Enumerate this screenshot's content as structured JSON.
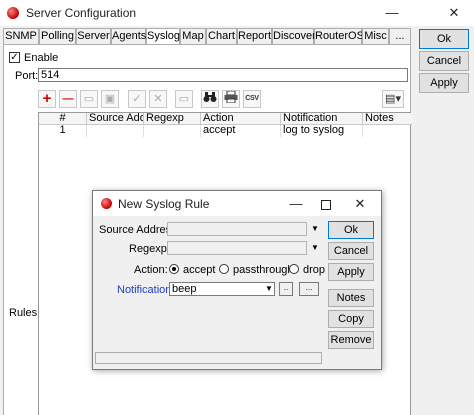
{
  "window": {
    "title": "Server Configuration",
    "minimize": "—",
    "close": "✕"
  },
  "tabs": [
    "SNMP",
    "Polling",
    "Server",
    "Agents",
    "Syslog",
    "Map",
    "Chart",
    "Report",
    "Discover",
    "RouterOS",
    "Misc",
    "..."
  ],
  "active_tab": "Syslog",
  "side_buttons": {
    "ok": "Ok",
    "cancel": "Cancel",
    "apply": "Apply"
  },
  "syslog": {
    "enable_label": "Enable",
    "enable_checked": "✓",
    "port_label": "Port:",
    "port_value": "514",
    "rules_label": "Rules:"
  },
  "toolbar": {
    "add": "+",
    "remove": "—",
    "find_icon": "binoculars-icon",
    "print_icon": "printer-icon",
    "csv": "CSV",
    "columns": "▾"
  },
  "rules_table": {
    "headers": [
      "#",
      "Source Add...",
      "Regexp",
      "Action",
      "Notification",
      "Notes"
    ],
    "rows": [
      [
        "1",
        "",
        "",
        "accept",
        "log to syslog",
        ""
      ]
    ]
  },
  "dialog": {
    "title": "New Syslog Rule",
    "minimize": "—",
    "close": "✕",
    "source_label": "Source Address:",
    "source_value": "",
    "regexp_label": "Regexp:",
    "regexp_value": "",
    "action_label": "Action:",
    "action_options": [
      "accept",
      "passthrough",
      "drop"
    ],
    "action_selected": "accept",
    "notification_label": "Notification:",
    "notification_value": "beep",
    "btn_small_1": "..",
    "btn_small_2": "...",
    "buttons": {
      "ok": "Ok",
      "cancel": "Cancel",
      "apply": "Apply",
      "notes": "Notes",
      "copy": "Copy",
      "remove": "Remove"
    },
    "label_highlight_color": "#1a3ccc"
  }
}
